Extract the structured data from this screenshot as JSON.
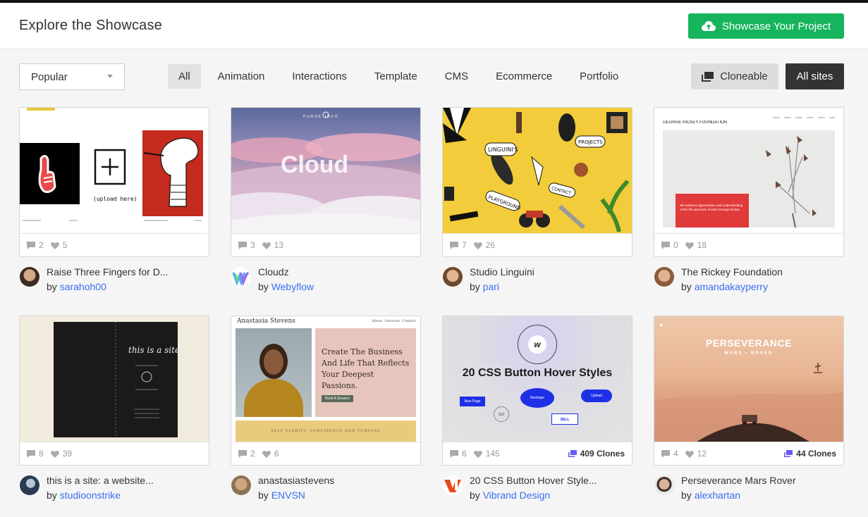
{
  "header": {
    "title": "Explore the Showcase",
    "cta_label": "Showcase Your Project",
    "cta_color": "#16b45d"
  },
  "filters": {
    "sort_selected": "Popular",
    "tabs": [
      "All",
      "Animation",
      "Interactions",
      "Template",
      "CMS",
      "Ecommerce",
      "Portfolio"
    ],
    "active_tab": "All",
    "cloneable_label": "Cloneable",
    "all_sites_label": "All sites"
  },
  "thumb_text": {
    "c1_caption": "(upload here)",
    "c2_word": "Cloud",
    "c2_nav": "PURSE INFO",
    "c3_tag1": "LINGUINI'S",
    "c3_tag2": "PLAYGROUND",
    "c3_tag3": "PROJECTS",
    "c3_tag4": "CONTACT",
    "c4_brand": "GEORGE RICKEY FOUNDATION",
    "c4_box": "We advance appreciation and understanding of the life and work of artist George Rickey.",
    "c5_title": "this is a site",
    "c6_name": "Anastasia Stevens",
    "c6_nav": "About  Services  Contact",
    "c6_headline": "Create The Business And Life That Reflects Your Deepest Passions.",
    "c6_btn": "Book A Session",
    "c6_footer": "SELF CLARITY, CONFIDENCE AND PURPOSE",
    "c7_title": "20 CSS Button Hover Styles",
    "c7_b1": "New Page",
    "c7_b2": "Reshape",
    "c7_b3": "Upload",
    "c7_b4": "SELL",
    "c7_b5": "GO",
    "c8_title": "PERSEVERANCE",
    "c8_sub": "MARS • ROVER"
  },
  "cards": [
    {
      "title": "Raise Three Fingers for D...",
      "by": "by",
      "author": "sarahoh00",
      "comments": "2",
      "likes": "5",
      "clones": ""
    },
    {
      "title": "Cloudz",
      "by": "by",
      "author": "Webyflow",
      "comments": "3",
      "likes": "13",
      "clones": ""
    },
    {
      "title": "Studio Linguini",
      "by": "by",
      "author": "pari",
      "comments": "7",
      "likes": "26",
      "clones": ""
    },
    {
      "title": "The Rickey Foundation",
      "by": "by",
      "author": "amandakayperry",
      "comments": "0",
      "likes": "18",
      "clones": ""
    },
    {
      "title": "this is a site: a website...",
      "by": "by",
      "author": "studioonstrike",
      "comments": "8",
      "likes": "39",
      "clones": ""
    },
    {
      "title": "anastasiastevens",
      "by": "by",
      "author": "ENVSN",
      "comments": "2",
      "likes": "6",
      "clones": ""
    },
    {
      "title": "20 CSS Button Hover Style...",
      "by": "by",
      "author": "Vibrand Design",
      "comments": "6",
      "likes": "145",
      "clones": "409 Clones"
    },
    {
      "title": "Perseverance Mars Rover",
      "by": "by",
      "author": "alexhartan",
      "comments": "4",
      "likes": "12",
      "clones": "44 Clones"
    }
  ]
}
